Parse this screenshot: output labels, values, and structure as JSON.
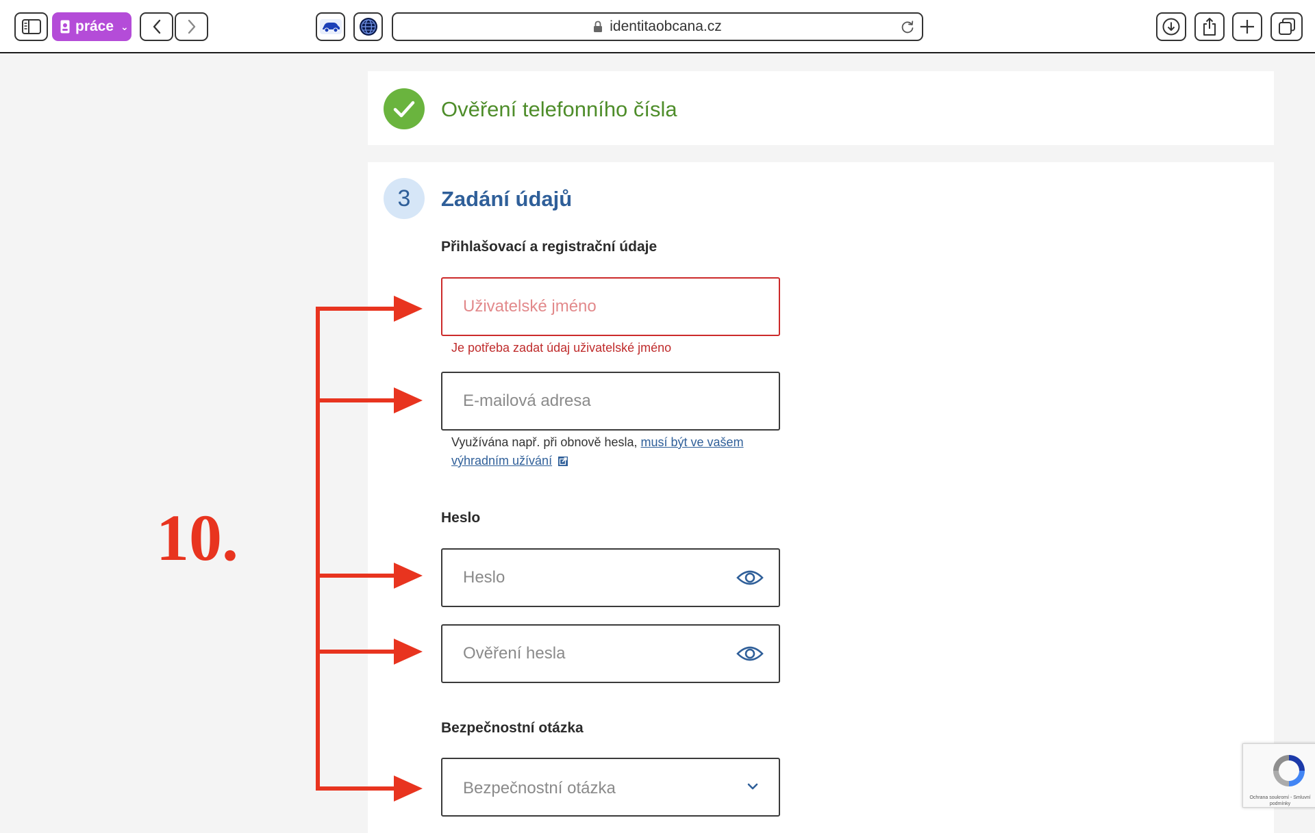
{
  "browser": {
    "profile_label": "práce",
    "url": "identitaobcana.cz"
  },
  "step_done": {
    "title": "Ověření telefonního čísla"
  },
  "step_current": {
    "number": "3",
    "title": "Zadání údajů"
  },
  "form": {
    "login_section_label": "Přihlašovací a registrační údaje",
    "username_placeholder": "Uživatelské jméno",
    "username_error": "Je potřeba zadat údaj uživatelské jméno",
    "email_placeholder": "E-mailová adresa",
    "email_hint_text": "Využívána např. při obnově hesla, ",
    "email_hint_link": "musí být ve vašem výhradním užívání",
    "password_section_label": "Heslo",
    "password_placeholder": "Heslo",
    "password_confirm_placeholder": "Ověření hesla",
    "security_section_label": "Bezpečnostní otázka",
    "security_select_placeholder": "Bezpečnostní otázka"
  },
  "annotation": {
    "number": "10.",
    "color": "#e8341f"
  },
  "recaptcha": {
    "footer_text": "Ochrana soukromí - Smluvní podmínky"
  },
  "colors": {
    "profile": "#b44cd8",
    "success": "#6ab43e",
    "primary": "#2f5f99",
    "error": "#cc2a2a"
  },
  "icons": [
    "sidebar-icon",
    "person-badge-icon",
    "chevron-left-icon",
    "chevron-right-icon",
    "car-extension-icon",
    "globe-extension-icon",
    "lock-icon",
    "reload-icon",
    "download-icon",
    "share-icon",
    "plus-icon",
    "tabs-icon",
    "checkmark-icon",
    "eye-icon",
    "chevron-down-icon",
    "external-link-icon",
    "recaptcha-icon"
  ]
}
